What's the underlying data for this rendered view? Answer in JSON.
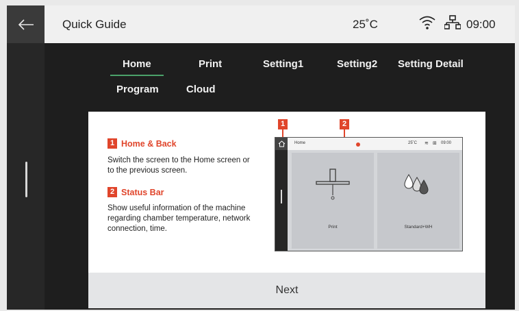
{
  "header": {
    "title": "Quick Guide",
    "temperature": "25˚C",
    "time": "09:00",
    "icons": [
      "back-arrow-icon",
      "wifi-icon",
      "network-icon"
    ]
  },
  "tabs": [
    {
      "label": "Home",
      "active": true
    },
    {
      "label": "Print",
      "active": false
    },
    {
      "label": "Setting1",
      "active": false
    },
    {
      "label": "Setting2",
      "active": false
    },
    {
      "label": "Setting Detail",
      "active": false
    },
    {
      "label": "Program",
      "active": false
    },
    {
      "label": "Cloud",
      "active": false
    }
  ],
  "guide": {
    "items": [
      {
        "number": "1",
        "title": "Home & Back",
        "description": "Switch the screen to the Home screen or to the previous screen."
      },
      {
        "number": "2",
        "title": "Status Bar",
        "description": "Show useful information of the machine regarding  chamber temperature, network connection, time."
      }
    ],
    "preview": {
      "marker_1": "1",
      "marker_2": "2",
      "title": "Home",
      "temperature": "25˚C",
      "time": "09:00",
      "panel_left_label": "Print",
      "panel_right_label": "Standard+WH"
    },
    "next_label": "Next"
  },
  "colors": {
    "accent": "#e0452b",
    "active_tab_underline": "#4ba26a",
    "background": "#1e1e1e"
  }
}
